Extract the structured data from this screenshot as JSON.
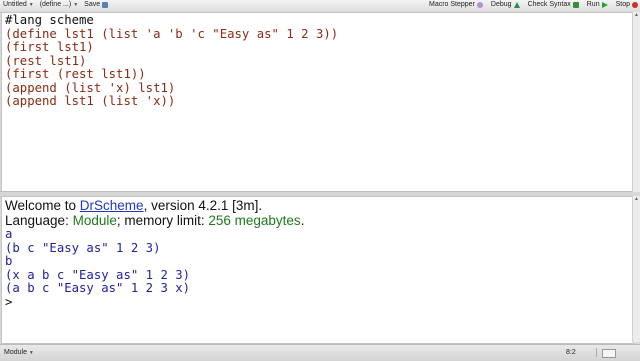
{
  "toolbar": {
    "file_name": "Untitled",
    "definitions_menu": "(define ...)",
    "save": "Save",
    "macro_stepper": "Macro Stepper",
    "debug": "Debug",
    "check_syntax": "Check Syntax",
    "run": "Run",
    "stop": "Stop"
  },
  "definitions": {
    "lines": [
      "#lang scheme",
      "(define lst1 (list 'a 'b 'c \"Easy as\" 1 2 3))",
      "(first lst1)",
      "(rest lst1)",
      "(first (rest lst1))",
      "(append (list 'x) lst1)",
      "(append lst1 (list 'x))"
    ]
  },
  "interactions": {
    "welcome_prefix": "Welcome to ",
    "welcome_link": "DrScheme",
    "welcome_suffix": ", version 4.2.1 [3m].",
    "language_prefix": "Language: ",
    "language_name": "Module",
    "memory_prefix": "; memory limit: ",
    "memory_value": "256 megabytes",
    "memory_suffix": ".",
    "results": [
      "a",
      "(b c \"Easy as\" 1 2 3)",
      "b",
      "(x a b c \"Easy as\" 1 2 3)",
      "(a b c \"Easy as\" 1 2 3 x)"
    ],
    "prompt": ">"
  },
  "status": {
    "language": "Module",
    "position": "8:2"
  },
  "icons": {
    "save": "save-icon",
    "macro": "macro-stepper-icon",
    "debug": "debug-icon",
    "check": "check-syntax-icon",
    "run": "run-icon",
    "stop": "stop-icon"
  },
  "colors": {
    "paren": "#8b2b12",
    "symbol": "#21247d",
    "string": "#1b7f1b",
    "result": "#1f1fa0",
    "link": "#1d3bb8",
    "language": "#1f7a1f"
  }
}
